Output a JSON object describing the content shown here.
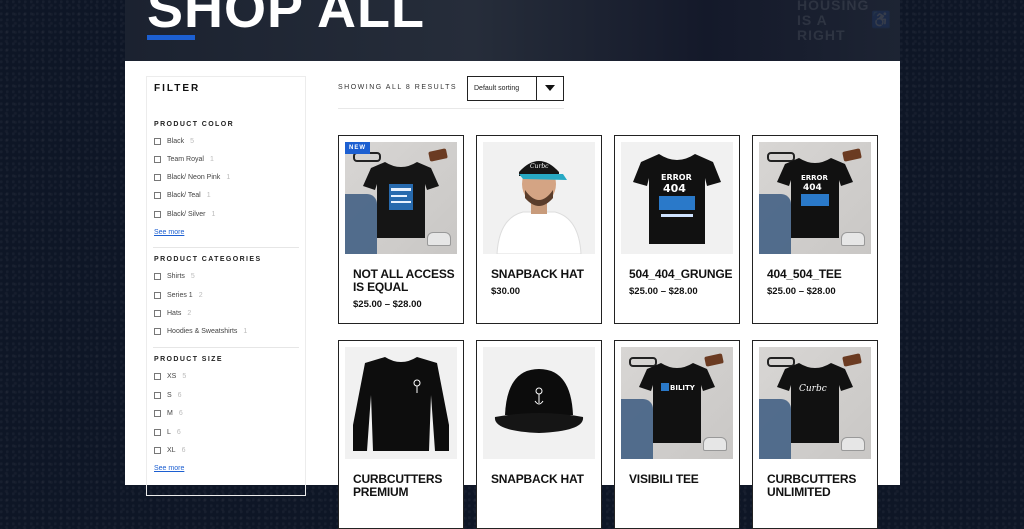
{
  "hero": {
    "title": "SHOP ALL",
    "watermark_line1": "HOUSING",
    "watermark_line2": "IS A",
    "watermark_line3": "RIGHT"
  },
  "sidebar": {
    "title": "FILTER",
    "color": {
      "title": "PRODUCT COLOR",
      "options": [
        {
          "label": "Black",
          "count": "5"
        },
        {
          "label": "Team Royal",
          "count": "1"
        },
        {
          "label": "Black/ Neon Pink",
          "count": "1"
        },
        {
          "label": "Black/ Teal",
          "count": "1"
        },
        {
          "label": "Black/ Silver",
          "count": "1"
        }
      ],
      "see_more": "See more"
    },
    "categories": {
      "title": "PRODUCT CATEGORIES",
      "options": [
        {
          "label": "Shirts",
          "count": "5"
        },
        {
          "label": "Series 1",
          "count": "2"
        },
        {
          "label": "Hats",
          "count": "2"
        },
        {
          "label": "Hoodies & Sweatshirts",
          "count": "1"
        }
      ]
    },
    "size": {
      "title": "PRODUCT SIZE",
      "options": [
        {
          "label": "XS",
          "count": "5"
        },
        {
          "label": "S",
          "count": "6"
        },
        {
          "label": "M",
          "count": "6"
        },
        {
          "label": "L",
          "count": "6"
        },
        {
          "label": "XL",
          "count": "6"
        }
      ],
      "see_more": "See more"
    }
  },
  "toolbar": {
    "result_count": "SHOWING ALL 8 RESULTS",
    "sort_label": "Default sorting"
  },
  "products": [
    {
      "title": "NOT ALL ACCESS IS EQUAL",
      "price": "$25.00 – $28.00",
      "badge": "NEW",
      "shirt_text": "NOT ALL ACCESS"
    },
    {
      "title": "SNAPBACK HAT",
      "price": "$30.00",
      "cap_text": "Curbcutters"
    },
    {
      "title": "504_404_GRUNGE",
      "price": "$25.00 – $28.00",
      "shirt_text": "ERROR 404"
    },
    {
      "title": "404_504_TEE",
      "price": "$25.00 – $28.00",
      "shirt_text": "ERROR 404"
    },
    {
      "title": "CURBCUTTERS PREMIUM",
      "price": ""
    },
    {
      "title": "SNAPBACK HAT",
      "price": ""
    },
    {
      "title": "VISIBILI TEE",
      "price": "",
      "shirt_text": "VISIBILITY"
    },
    {
      "title": "CURBCUTTERS UNLIMITED",
      "price": "",
      "shirt_text": "Curbcutters"
    }
  ],
  "colors": {
    "accent": "#1c5fd1",
    "background": "#0e1626",
    "card_border": "#222222"
  }
}
